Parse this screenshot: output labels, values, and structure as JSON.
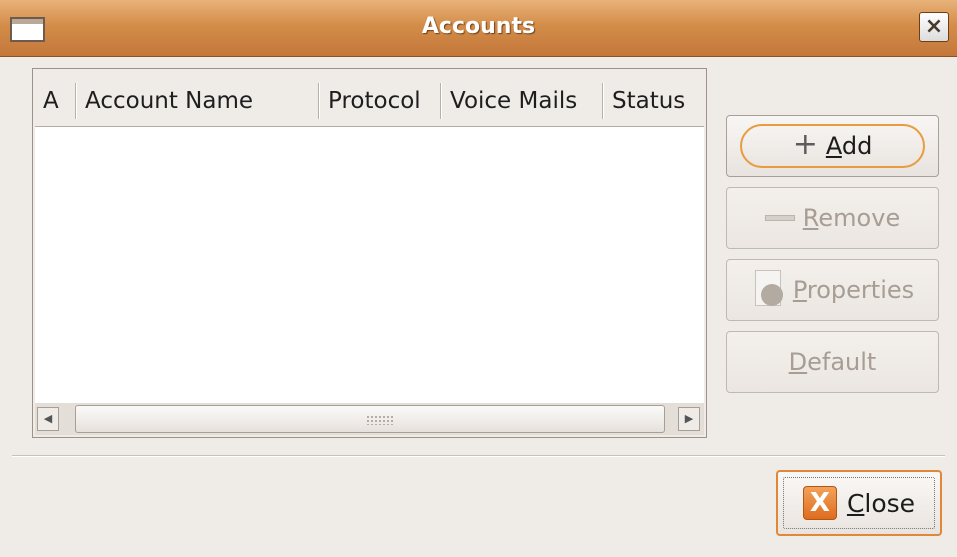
{
  "window": {
    "title": "Accounts",
    "close_glyph": "×"
  },
  "table": {
    "columns": [
      "A",
      "Account Name",
      "Protocol",
      "Voice Mails",
      "Status"
    ],
    "rows": []
  },
  "scrollbar": {
    "left_arrow": "◀",
    "right_arrow": "▶"
  },
  "buttons": {
    "add": {
      "underline_letter": "A",
      "rest": "dd",
      "icon": "plus-icon",
      "state": "focused"
    },
    "remove": {
      "underline_letter": "R",
      "rest": "emove",
      "icon": "minus-icon",
      "state": "disabled"
    },
    "properties": {
      "underline_letter": "P",
      "rest": "roperties",
      "icon": "properties-icon",
      "state": "disabled"
    },
    "default": {
      "underline_letter": "D",
      "rest": "efault",
      "state": "disabled"
    },
    "close": {
      "underline_letter": "C",
      "rest": "lose",
      "icon": "close-x-icon",
      "icon_glyph": "X"
    }
  },
  "colors": {
    "titlebar": "#d48d49",
    "focus_ring": "#e89b3f",
    "close_icon": "#df6c1e"
  }
}
